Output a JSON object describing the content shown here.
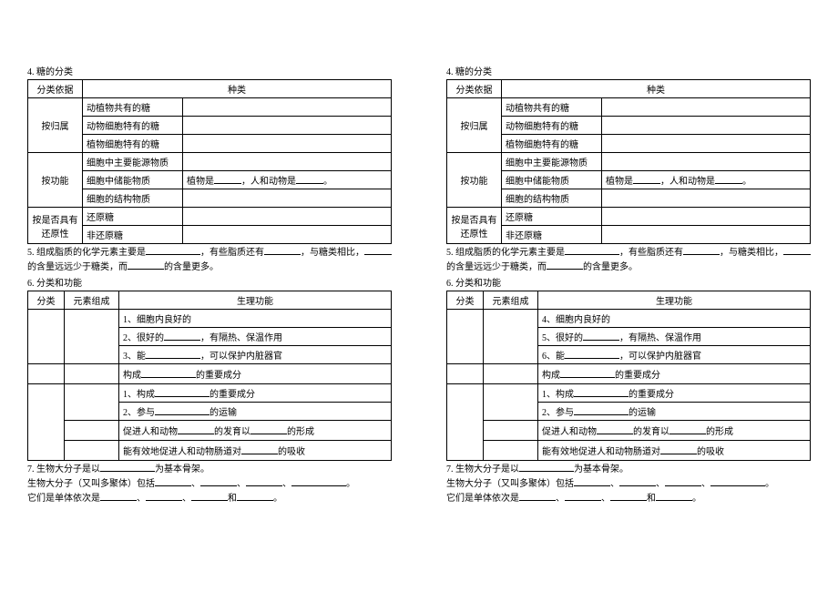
{
  "section4": {
    "title": "4. 糖的分类",
    "table": {
      "header1": "分类依据",
      "header2": "种类",
      "row1_left": "按归属",
      "row1a": "动植物共有的糖",
      "row1b": "动物细胞特有的糖",
      "row1c": "植物细胞特有的糖",
      "row2_left": "按功能",
      "row2a": "细胞中主要能源物质",
      "row2b": "细胞中储能物质",
      "row2b_right_prefix": "植物是",
      "row2b_right_mid": "，人和动物是",
      "row2b_right_suffix": "。",
      "row2c": "细胞的结构物质",
      "row3_left": "按是否具有还原性",
      "row3a": "还原糖",
      "row3b": "非还原糖"
    }
  },
  "section5": {
    "text_a": "5. 组成脂质的化学元素主要是",
    "text_b": "，有些脂质还有",
    "text_c": "，与糖类相比，",
    "text_d": "的含量远远少于糖类，而",
    "text_e": "的含量更多。"
  },
  "section6": {
    "title": "6. 分类和功能",
    "header1": "分类",
    "header2": "元素组成",
    "header3": "生理功能",
    "rows_left": {
      "r1a": "1、细胞内良好的",
      "r1b_pre": "2、很好的",
      "r1b_post": "，有隔热、保温作用",
      "r1c_pre": "3、能",
      "r1c_post": "，可以保护内脏器官",
      "r2_pre": "构成",
      "r2_post": "的重要成分",
      "r3a_pre": "1、构成",
      "r3a_post": "的重要成分",
      "r3b_pre": "2、参与",
      "r3b_post": "的运输",
      "r4_pre": "促进人和动物",
      "r4_mid": "的发育以",
      "r4_post": "的形成",
      "r5_pre": "能有效地促进人和动物肠道对",
      "r5_post": "的吸收"
    },
    "rows_right": {
      "r1a": "4、细胞内良好的",
      "r1b_pre": "5、很好的",
      "r1b_post": "，有隔热、保温作用",
      "r1c_pre": "6、能",
      "r1c_post": "，可以保护内脏器官"
    }
  },
  "section7": {
    "text_a": "7. 生物大分子是以",
    "text_b": "为基本骨架。",
    "text_c": "生物大分子（又叫多聚体）包括",
    "text_d": "、",
    "text_e": "、",
    "text_f": "、",
    "text_g": "。",
    "text_h": "它们是单体依次是",
    "text_i": "、",
    "text_j": "、",
    "text_k": "和",
    "text_l": "。"
  }
}
